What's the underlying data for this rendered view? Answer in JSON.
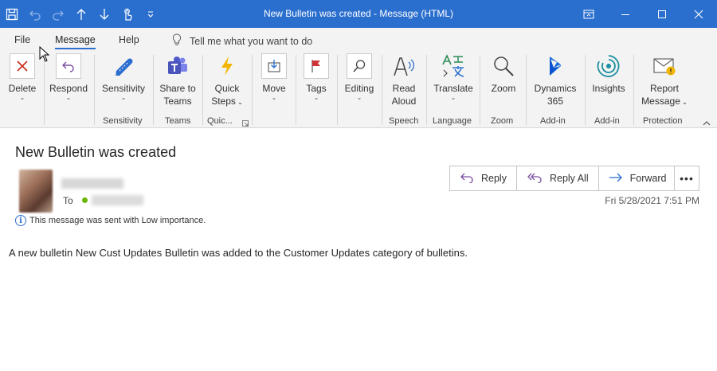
{
  "window": {
    "title": "New Bulletin was created  -  Message (HTML)"
  },
  "quick_access": {
    "icons": [
      "save-icon",
      "undo-icon",
      "redo-icon",
      "up-arrow-icon",
      "down-arrow-icon",
      "touch-mode-icon",
      "customize-icon"
    ]
  },
  "tabs": [
    {
      "label": "File",
      "active": false
    },
    {
      "label": "Message",
      "active": true
    },
    {
      "label": "Help",
      "active": false
    }
  ],
  "tell_me": {
    "placeholder": "Tell me what you want to do"
  },
  "ribbon": {
    "buttons": {
      "delete": "Delete",
      "respond": "Respond",
      "sensitivity": "Sensitivity",
      "share_to_teams_1": "Share to",
      "share_to_teams_2": "Teams",
      "quick_steps_1": "Quick",
      "quick_steps_2": "Steps",
      "move": "Move",
      "tags": "Tags",
      "editing": "Editing",
      "read_aloud_1": "Read",
      "read_aloud_2": "Aloud",
      "translate": "Translate",
      "zoom": "Zoom",
      "dynamics_1": "Dynamics",
      "dynamics_2": "365",
      "insights": "Insights",
      "report_1": "Report",
      "report_2": "Message"
    },
    "groups": {
      "sensitivity": "Sensitivity",
      "teams": "Teams",
      "quick": "Quic...",
      "speech": "Speech",
      "language": "Language",
      "zoom": "Zoom",
      "addin_1": "Add-in",
      "addin_2": "Add-in",
      "protection": "Protection"
    }
  },
  "message": {
    "subject": "New Bulletin was created",
    "to_label": "To",
    "date": "Fri 5/28/2021 7:51 PM",
    "importance": "This message was sent with Low importance.",
    "body": "A new bulletin New Cust Updates Bulletin was added to the Customer Updates category of bulletins."
  },
  "actions": {
    "reply": "Reply",
    "reply_all": "Reply All",
    "forward": "Forward",
    "more": "•••"
  },
  "colors": {
    "titlebar": "#2b6fce",
    "ribbon_bg": "#f3f3f3",
    "accent": "#2b6fce",
    "delete_red": "#c42b1c",
    "respond_purple": "#7b4fa0",
    "quick_steps_yellow": "#f2b600",
    "tags_red": "#d13438"
  }
}
